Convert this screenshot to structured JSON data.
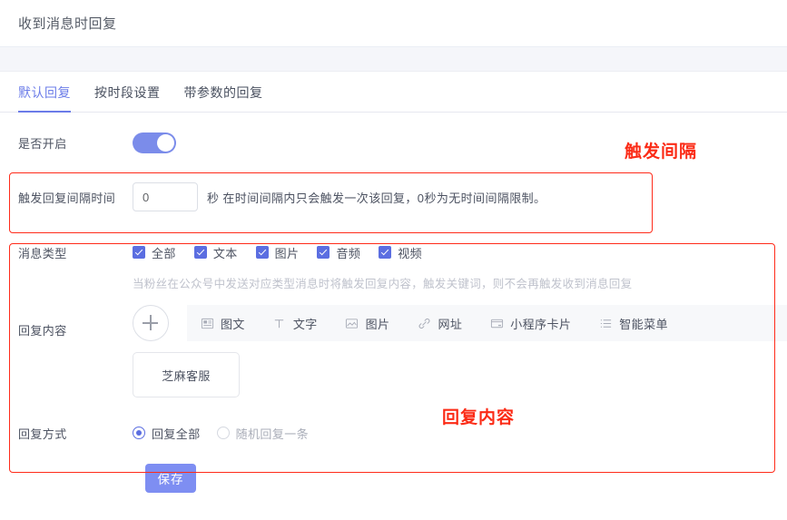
{
  "header": {
    "title": "收到消息时回复"
  },
  "tabs": [
    {
      "label": "默认回复",
      "active": true
    },
    {
      "label": "按时段设置",
      "active": false
    },
    {
      "label": "带参数的回复",
      "active": false
    }
  ],
  "form": {
    "enable": {
      "label": "是否开启",
      "toggle_on": true
    },
    "interval": {
      "label": "触发回复间隔时间",
      "value": "0",
      "placeholder": "0",
      "suffix": "秒 在时间间隔内只会触发一次该回复，0秒为无时间间隔限制。"
    },
    "message_type": {
      "label": "消息类型",
      "options": [
        {
          "label": "全部",
          "checked": true
        },
        {
          "label": "文本",
          "checked": true
        },
        {
          "label": "图片",
          "checked": true
        },
        {
          "label": "音频",
          "checked": true
        },
        {
          "label": "视频",
          "checked": true
        }
      ],
      "hint": "当粉丝在公众号中发送对应类型消息时将触发回复内容，触发关键词，则不会再触发收到消息回复"
    },
    "reply_content": {
      "label": "回复内容",
      "add_button": "+",
      "types": [
        {
          "label": "图文",
          "icon": "article-icon"
        },
        {
          "label": "文字",
          "icon": "text-icon"
        },
        {
          "label": "图片",
          "icon": "image-icon"
        },
        {
          "label": "网址",
          "icon": "link-icon"
        },
        {
          "label": "小程序卡片",
          "icon": "miniprogram-card-icon"
        },
        {
          "label": "智能菜单",
          "icon": "smart-menu-icon"
        }
      ],
      "cards": [
        {
          "title": "芝麻客服"
        }
      ]
    },
    "reply_way": {
      "label": "回复方式",
      "options": [
        {
          "label": "回复全部",
          "checked": true
        },
        {
          "label": "随机回复一条",
          "checked": false
        }
      ]
    },
    "save_label": "保存"
  },
  "annotations": [
    {
      "text": "触发间隔",
      "color": "#fb2b16"
    },
    {
      "text": "回复内容",
      "color": "#fb2b16"
    }
  ],
  "colors": {
    "accent": "#6b7ce8",
    "toggle_on": "#7b8cea",
    "checkbox": "#5b6ee1",
    "save_button": "#7e8ef2",
    "annotation_red": "#fb2b16",
    "toolbar_bg": "#f7f8fa"
  }
}
